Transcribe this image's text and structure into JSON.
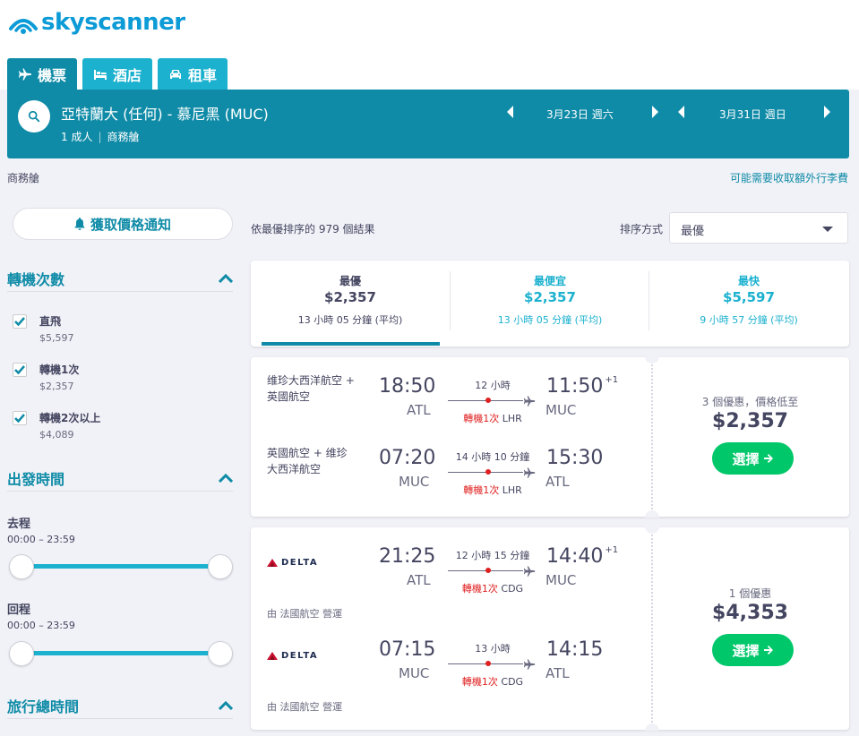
{
  "brand": {
    "name": "skyscanner",
    "color": "#0c9bd7"
  },
  "tabs": [
    {
      "label": "機票",
      "icon": "plane-icon"
    },
    {
      "label": "酒店",
      "icon": "bed-icon"
    },
    {
      "label": "租車",
      "icon": "car-icon"
    }
  ],
  "search": {
    "route": "亞特蘭大 (任何) - 慕尼黑 (MUC)",
    "passengers": "1 成人",
    "cabin": "商務艙",
    "depart_date": "3月23日 週六",
    "return_date": "3月31日 週日"
  },
  "cabin_label": "商務艙",
  "baggage_link": "可能需要收取額外行李費",
  "price_alert": "獲取價格通知",
  "filters": {
    "stops": {
      "title": "轉機次數",
      "items": [
        {
          "label": "直飛",
          "price": "$5,597",
          "checked": true
        },
        {
          "label": "轉機1次",
          "price": "$2,357",
          "checked": true
        },
        {
          "label": "轉機2次以上",
          "price": "$4,089",
          "checked": true
        }
      ]
    },
    "times": {
      "title": "出發時間",
      "outbound": {
        "label": "去程",
        "range": "00:00 – 23:59"
      },
      "inbound": {
        "label": "回程",
        "range": "00:00 – 23:59"
      }
    },
    "duration": {
      "title": "旅行總時間"
    }
  },
  "results": {
    "count_text": "依最優排序的 979 個結果",
    "sort_label": "排序方式",
    "sort_value": "最優"
  },
  "summary": [
    {
      "label": "最優",
      "price": "$2,357",
      "duration": "13 小時 05 分鐘 (平均)"
    },
    {
      "label": "最便宜",
      "price": "$2,357",
      "duration": "13 小時 05 分鐘 (平均)"
    },
    {
      "label": "最快",
      "price": "$5,597",
      "duration": "9 小時 57 分鐘 (平均)"
    }
  ],
  "cards": [
    {
      "legs": [
        {
          "airline": "维珍大西洋航空 + 英國航空",
          "dep_time": "18:50",
          "dep_code": "ATL",
          "arr_time": "11:50",
          "arr_plus": "+1",
          "arr_code": "MUC",
          "duration": "12 小時",
          "stops": "轉機1次",
          "via": "LHR"
        },
        {
          "airline": "英國航空 + 维珍大西洋航空",
          "dep_time": "07:20",
          "dep_code": "MUC",
          "arr_time": "15:30",
          "arr_plus": "",
          "arr_code": "ATL",
          "duration": "14 小時 10 分鐘",
          "stops": "轉機1次",
          "via": "LHR"
        }
      ],
      "deals": "3 個優惠，價格低至",
      "price": "$2,357",
      "select_label": "選擇"
    },
    {
      "legs": [
        {
          "airline": "DELTA",
          "operated": "由 法國航空 營運",
          "dep_time": "21:25",
          "dep_code": "ATL",
          "arr_time": "14:40",
          "arr_plus": "+1",
          "arr_code": "MUC",
          "duration": "12 小時 15 分鐘",
          "stops": "轉機1次",
          "via": "CDG"
        },
        {
          "airline": "DELTA",
          "operated": "由 法國航空 營運",
          "dep_time": "07:15",
          "dep_code": "MUC",
          "arr_time": "14:15",
          "arr_plus": "",
          "arr_code": "ATL",
          "duration": "13 小時",
          "stops": "轉機1次",
          "via": "CDG"
        }
      ],
      "deals": "1 個優惠",
      "price": "$4,353",
      "select_label": "選擇"
    }
  ]
}
